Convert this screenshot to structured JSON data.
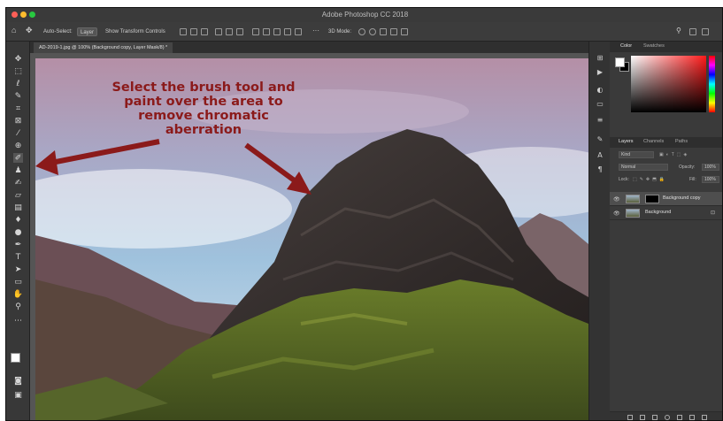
{
  "window": {
    "title": "Adobe Photoshop CC 2018",
    "traffic_colors": [
      "#ff5f57",
      "#febc2e",
      "#28c840"
    ]
  },
  "options_bar": {
    "auto_select_label": "Auto-Select:",
    "auto_select_value": "Layer",
    "transform_label": "Show Transform Controls",
    "mode_label": "3D Mode:"
  },
  "document": {
    "tab_label": "AD-2019-1.jpg @ 100% (Background copy, Layer Mask/8) *"
  },
  "annotation": {
    "caption": "Select the brush tool and paint over the area to remove chromatic aberration",
    "arrow_color": "#8b1a1a"
  },
  "tools": [
    "move-tool",
    "marquee-tool",
    "lasso-tool",
    "quick-select-tool",
    "crop-tool",
    "frame-tool",
    "eyedropper-tool",
    "healing-tool",
    "brush-tool",
    "stamp-tool",
    "history-brush-tool",
    "eraser-tool",
    "gradient-tool",
    "blur-tool",
    "dodge-tool",
    "pen-tool",
    "type-tool",
    "path-select-tool",
    "shape-tool",
    "hand-tool",
    "zoom-tool",
    "more-tools"
  ],
  "panels": {
    "color_tabs": [
      "Color",
      "Swatches"
    ],
    "layer_tabs": [
      "Layers",
      "Channels",
      "Paths"
    ],
    "kind_label": "Kind",
    "blend_mode": "Normal",
    "opacity_label": "Opacity:",
    "opacity_value": "100%",
    "lock_label": "Lock:",
    "fill_label": "Fill:",
    "fill_value": "100%",
    "layers": [
      {
        "name": "Background copy"
      },
      {
        "name": "Background"
      }
    ]
  }
}
